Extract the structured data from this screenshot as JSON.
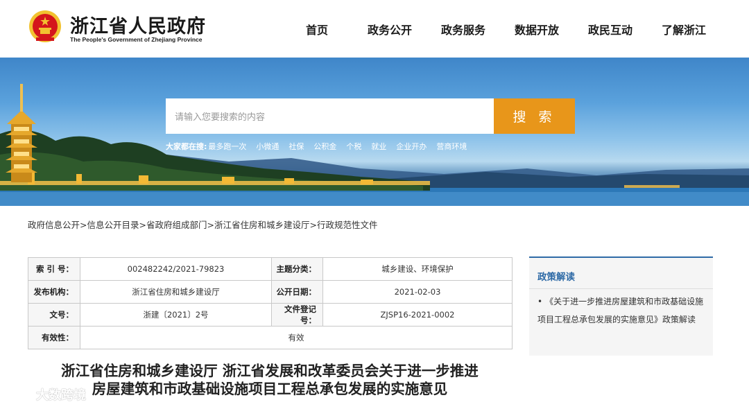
{
  "header": {
    "site_title": "浙江省人民政府",
    "site_subtitle": "The People's Government of Zhejiang Province",
    "nav": [
      {
        "label": "首页"
      },
      {
        "label": "政务公开"
      },
      {
        "label": "政务服务"
      },
      {
        "label": "数据开放"
      },
      {
        "label": "政民互动"
      },
      {
        "label": "了解浙江"
      }
    ]
  },
  "search": {
    "placeholder": "请输入您要搜索的内容",
    "button_label": "搜 索",
    "hot_label": "大家都在搜:",
    "hot_items": [
      "最多跑一次",
      "小微通",
      "社保",
      "公积金",
      "个税",
      "就业",
      "企业开办",
      "营商环境"
    ]
  },
  "breadcrumb": [
    "政府信息公开",
    "信息公开目录",
    "省政府组成部门",
    "浙江省住房和城乡建设厅",
    "行政规范性文件"
  ],
  "breadcrumb_sep": ">",
  "info": {
    "index_label": "索 引 号：",
    "index_value": "002482242/2021-79823",
    "category_label": "主题分类：",
    "category_value": "城乡建设、环境保护",
    "publisher_label": "发布机构：",
    "publisher_value": "浙江省住房和城乡建设厅",
    "date_label": "公开日期：",
    "date_value": "2021-02-03",
    "docno_label": "文号：",
    "docno_value": "浙建〔2021〕2号",
    "regno_label": "文件登记号：",
    "regno_value": "ZJSP16-2021-0002",
    "validity_label": "有效性：",
    "validity_value": "有效"
  },
  "sidebar": {
    "title": "政策解读",
    "bullet": "•",
    "item": "《关于进一步推进房屋建筑和市政基础设施项目工程总承包发展的实施意见》政策解读"
  },
  "document": {
    "title_line1": "浙江省住房和城乡建设厅 浙江省发展和改革委员会关于进一步推进",
    "title_line2": "房屋建筑和市政基础设施项目工程总承包发展的实施意见"
  },
  "watermark": {
    "text": "大数跨境"
  },
  "colors": {
    "accent_blue": "#2e6aa6",
    "search_orange": "#e8961a",
    "emblem_red": "#d4161b",
    "emblem_gold": "#f2c230"
  },
  "icons": {
    "emblem": "national-emblem-icon",
    "watermark_logo": "watermark-logo-icon"
  }
}
